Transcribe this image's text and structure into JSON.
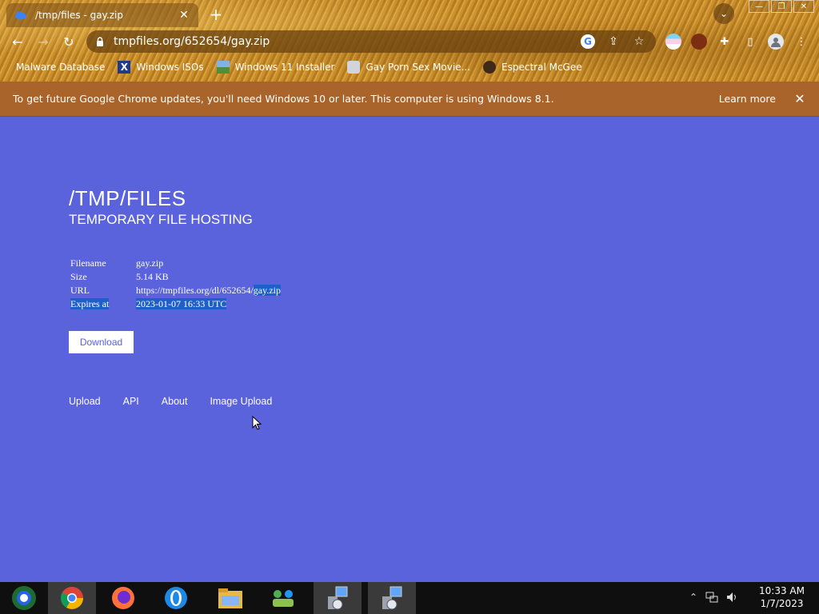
{
  "tab": {
    "title": "/tmp/files - gay.zip",
    "close": "✕"
  },
  "newtab": "+",
  "tab_dropdown": "⌄",
  "window": {
    "minimize": "—",
    "restore": "❐",
    "close": "✕"
  },
  "nav": {
    "back": "←",
    "forward": "→",
    "reload": "↻"
  },
  "address": {
    "url": "tmpfiles.org/652654/gay.zip"
  },
  "omni_icons": {
    "google": "G",
    "share": "⇪",
    "star": "☆"
  },
  "extensions": {
    "puzzle": "✚",
    "sidepanel": "▯",
    "menu": "⋮"
  },
  "bookmarks": [
    {
      "label": "Malware Database"
    },
    {
      "label": "Windows ISOs"
    },
    {
      "label": "Windows 11 Installer"
    },
    {
      "label": "Gay Porn Sex Movie..."
    },
    {
      "label": "Espectral McGee"
    }
  ],
  "infobar": {
    "message": "To get future Google Chrome updates, you'll need Windows 10 or later. This computer is using Windows 8.1.",
    "learn_more": "Learn more",
    "close": "✕"
  },
  "site": {
    "title": "/TMP/FILES",
    "subtitle": "TEMPORARY FILE HOSTING"
  },
  "file_info": [
    {
      "key": "Filename",
      "value": "gay.zip"
    },
    {
      "key": "Size",
      "value": "5.14 KB"
    },
    {
      "key": "URL",
      "value": "https://tmpfiles.org/dl/652654/gay.zip"
    },
    {
      "key": "Expires at",
      "value": "2023-01-07 16:33 UTC"
    }
  ],
  "download_label": "Download",
  "footer_links": [
    "Upload",
    "API",
    "About",
    "Image Upload"
  ],
  "taskbar": {
    "time": "10:33 AM",
    "date": "1/7/2023",
    "tray_chevron": "⌃"
  },
  "colors": {
    "page_bg": "#5a62dc",
    "infobar_bg": "#a8642a",
    "selection": "#1f5fc9"
  }
}
